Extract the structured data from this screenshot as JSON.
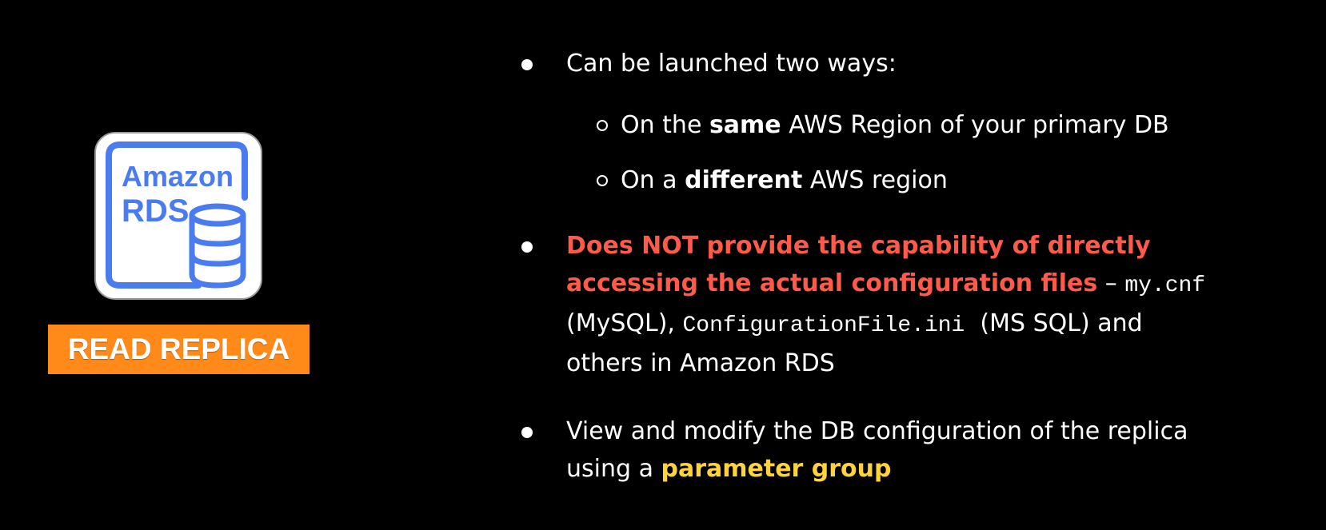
{
  "logo": {
    "line1": "Amazon",
    "line2": "RDS",
    "accent_color": "#4a7cf0",
    "icon": "database-icon"
  },
  "badge": {
    "label": "READ REPLICA",
    "color": "#ff8a1a"
  },
  "bullets": {
    "b1": {
      "text": "Can be launched two ways:"
    },
    "sub1": {
      "pre": "On the ",
      "bold": "same",
      "post": " AWS Region of your primary DB"
    },
    "sub2": {
      "pre": "On a ",
      "bold": "different",
      "post": " AWS region"
    },
    "b2": {
      "red_line1": "Does NOT provide the capability of directly",
      "red_line2": "accessing the actual configuration files",
      "dash": " – ",
      "code1": "my.cnf",
      "mid1": "(MySQL), ",
      "code2": "ConfigurationFile.ini",
      "mid2": "  (MS SQL) and",
      "tail": "others in Amazon RDS",
      "highlight_color": "#ff5a4a"
    },
    "b3": {
      "line1": "View and modify the DB configuration of the replica",
      "pre": "using a ",
      "highlight": "parameter group",
      "highlight_color": "#ffd43b"
    }
  }
}
